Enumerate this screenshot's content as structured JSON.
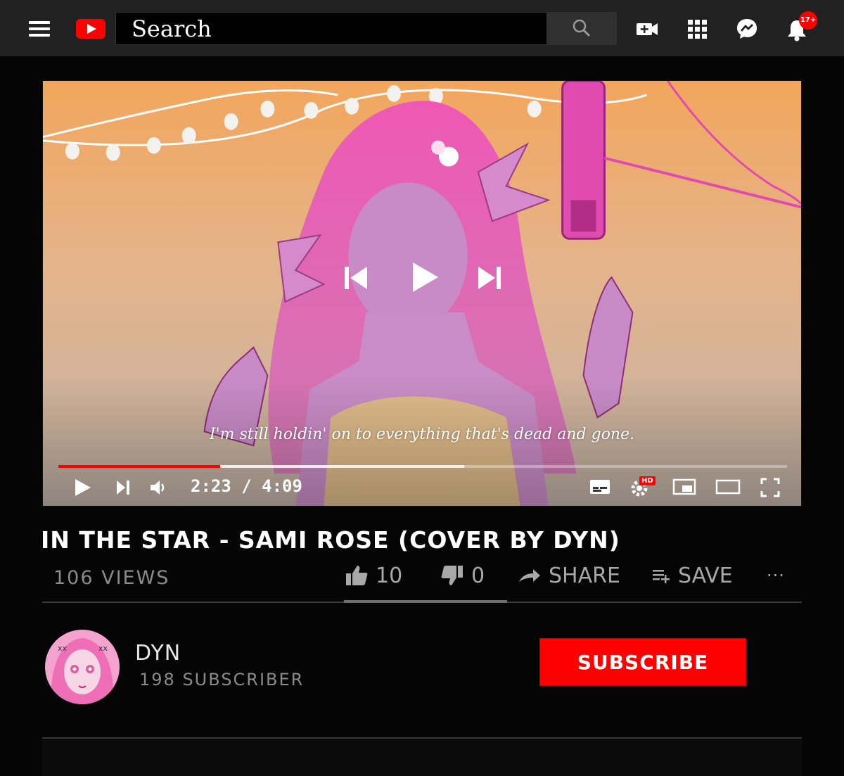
{
  "search": {
    "placeholder": "Search"
  },
  "topbar": {
    "notification_badge": "17+",
    "icons": [
      "menu-icon",
      "youtube-logo",
      "search-icon",
      "create-video-icon",
      "apps-grid-icon",
      "messages-icon",
      "notifications-bell-icon"
    ]
  },
  "player": {
    "subtitle": "I'm still holdin' on to everything that's dead and gone.",
    "time_current": "2:23",
    "time_total": "4:09",
    "time_display": "2:23 / 4:09",
    "progress_fraction": 0.222,
    "buffer_fraction": 0.557,
    "hd_badge": "HD"
  },
  "video": {
    "title": "IN THE STAR - SAMI ROSE (COVER BY DYN)",
    "views": "106 VIEWS",
    "likes": "10",
    "dislikes": "0",
    "share_label": "SHARE",
    "save_label": "SAVE",
    "more_label": "···"
  },
  "channel": {
    "name": "DYN",
    "subscribers": "198 SUBSCRIBER",
    "subscribe_label": "SUBSCRIBE"
  },
  "colors": {
    "accent": "#ff0000",
    "topbar": "#212121",
    "page_background": "#050505"
  }
}
